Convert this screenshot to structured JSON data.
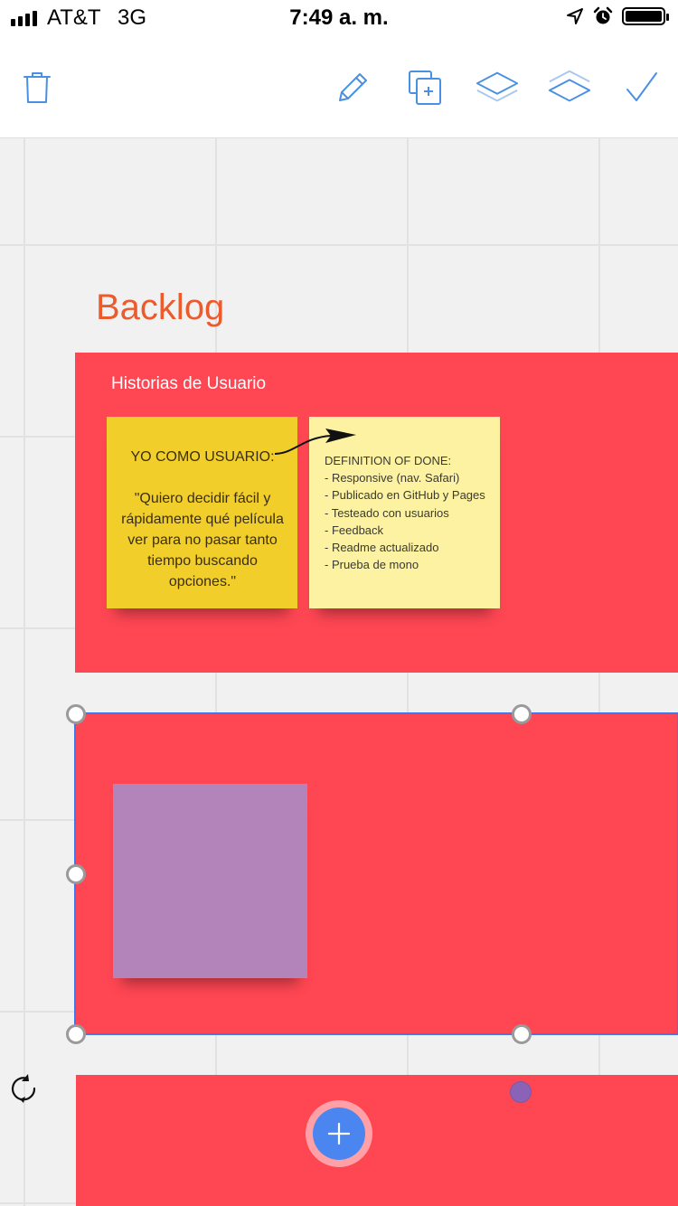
{
  "status_bar": {
    "carrier": "AT&T",
    "network": "3G",
    "time": "7:49 a. m.",
    "icons": [
      "location-arrow-icon",
      "alarm-icon",
      "battery-icon"
    ]
  },
  "toolbar": {
    "icons": [
      "trash-icon",
      "pencil-icon",
      "duplicate-icon",
      "layer-up-icon",
      "layer-down-icon",
      "checkmark-icon"
    ],
    "accent_color": "#4a90e2"
  },
  "board": {
    "title": "Backlog",
    "title_color": "#ec5b2c",
    "frame_color": "#ff4653",
    "frames": [
      {
        "label": "Historias de Usuario",
        "stickies": [
          {
            "color": "#f2ce2b",
            "text": "YO COMO USUARIO:\n\n\"Quiero decidir fácil y rápidamente qué película ver para no pasar tanto tiempo buscando opciones.\""
          },
          {
            "color": "#fdf2a2",
            "text": "DEFINITION OF DONE:\n- Responsive (nav. Safari)\n- Publicado en GitHub y Pages\n- Testeado con usuarios\n- Feedback\n- Readme actualizado\n- Prueba de mono"
          }
        ]
      },
      {
        "label": "",
        "selected": true,
        "stickies": [
          {
            "color": "#b384ba",
            "text": ""
          }
        ]
      },
      {
        "label": "",
        "stickies": []
      }
    ]
  },
  "fab": {
    "icon": "plus-icon",
    "color": "#4b86f0"
  },
  "rotate": {
    "icon": "rotate-icon"
  }
}
